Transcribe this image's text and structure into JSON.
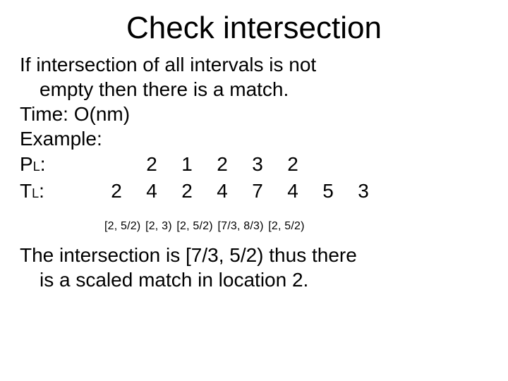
{
  "title": "Check intersection",
  "lines": {
    "intro1": "If intersection of all intervals is not",
    "intro2": "empty then there is a match.",
    "time": "Time: O(nm)",
    "example": "Example:"
  },
  "rows": {
    "pl_label_main": "P",
    "pl_label_sub": "L",
    "pl_colon": ":",
    "tl_label_main": "T",
    "tl_label_sub": "L",
    "tl_colon": ":",
    "pl": [
      "2",
      "1",
      "2",
      "3",
      "2"
    ],
    "tl": [
      "2",
      "4",
      "2",
      "4",
      "7",
      "4",
      "5",
      "3"
    ]
  },
  "intervals": [
    "[2, 5/2)",
    "[2, 3)",
    "[2, 5/2)",
    "[7/3, 8/3)",
    "[2, 5/2)"
  ],
  "conclusion": {
    "l1": "The intersection is [7/3, 5/2) thus there",
    "l2": "is a scaled match in location 2."
  }
}
